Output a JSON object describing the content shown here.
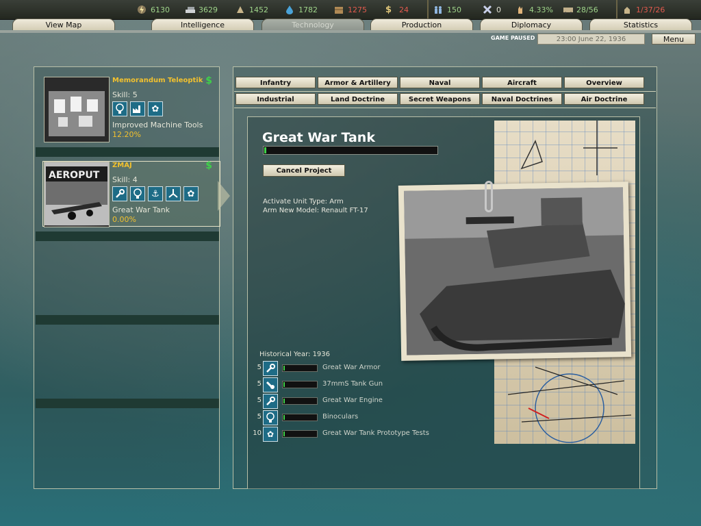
{
  "resources": [
    {
      "icon": "energy-icon",
      "value": "6130"
    },
    {
      "icon": "metal-icon",
      "value": "3629"
    },
    {
      "icon": "rare-materials-icon",
      "value": "1452"
    },
    {
      "icon": "oil-icon",
      "value": "1782"
    },
    {
      "icon": "supplies-icon",
      "value": "1275"
    },
    {
      "icon": "money-icon",
      "value": "24"
    },
    {
      "icon": "manpower-icon",
      "value": "150"
    },
    {
      "icon": "diplomats-icon",
      "value": "0"
    },
    {
      "icon": "dissent-icon",
      "value": "4.33%"
    },
    {
      "icon": "transports-icon",
      "value": "28/56"
    },
    {
      "icon": "nukes-icon",
      "value": "1/37/26"
    }
  ],
  "tabs": [
    "View Map",
    "Intelligence",
    "Technology",
    "Production",
    "Diplomacy",
    "Statistics"
  ],
  "active_tab": "Technology",
  "status": {
    "paused": "GAME PAUSED",
    "date": "23:00 June 22, 1936",
    "menu": "Menu"
  },
  "teams": [
    {
      "name": "Memorandum Teleoptik",
      "skill": "Skill: 5",
      "icons": [
        "lightbulb-icon",
        "industry-icon",
        "gear-icon"
      ],
      "project": "Improved Machine Tools",
      "progress": "12.20%"
    },
    {
      "name": "ZMAJ",
      "skill": "Skill: 4",
      "icons": [
        "wrench-icon",
        "lightbulb-icon",
        "anchor-icon",
        "propeller-icon",
        "gear-icon"
      ],
      "project": "Great War Tank",
      "progress": "0.00%"
    }
  ],
  "categories_row1": [
    "Infantry",
    "Armor & Artillery",
    "Naval",
    "Aircraft",
    "Overview"
  ],
  "categories_row2": [
    "Industrial",
    "Land Doctrine",
    "Secret Weapons",
    "Naval Doctrines",
    "Air Doctrine"
  ],
  "tech": {
    "title": "Great War Tank",
    "progress_fraction": 0.01,
    "cancel_label": "Cancel Project",
    "effects": [
      "Activate Unit Type: Arm",
      "Arm New Model: Renault FT-17"
    ],
    "historical_year": "Historical Year: 1936",
    "components": [
      {
        "level": "5",
        "icon": "wrench-icon",
        "name": "Great War Armor"
      },
      {
        "level": "5",
        "icon": "cannon-icon",
        "name": "37mmS Tank Gun"
      },
      {
        "level": "5",
        "icon": "wrench-icon",
        "name": "Great War Engine"
      },
      {
        "level": "5",
        "icon": "lightbulb-icon",
        "name": "Binoculars"
      },
      {
        "level": "10",
        "icon": "gear-icon",
        "name": "Great War Tank Prototype Tests"
      }
    ]
  },
  "colors": {
    "accent_gold": "#f2c12e",
    "progress_green": "#3fd04a",
    "icon_blue": "#1e6c86"
  }
}
